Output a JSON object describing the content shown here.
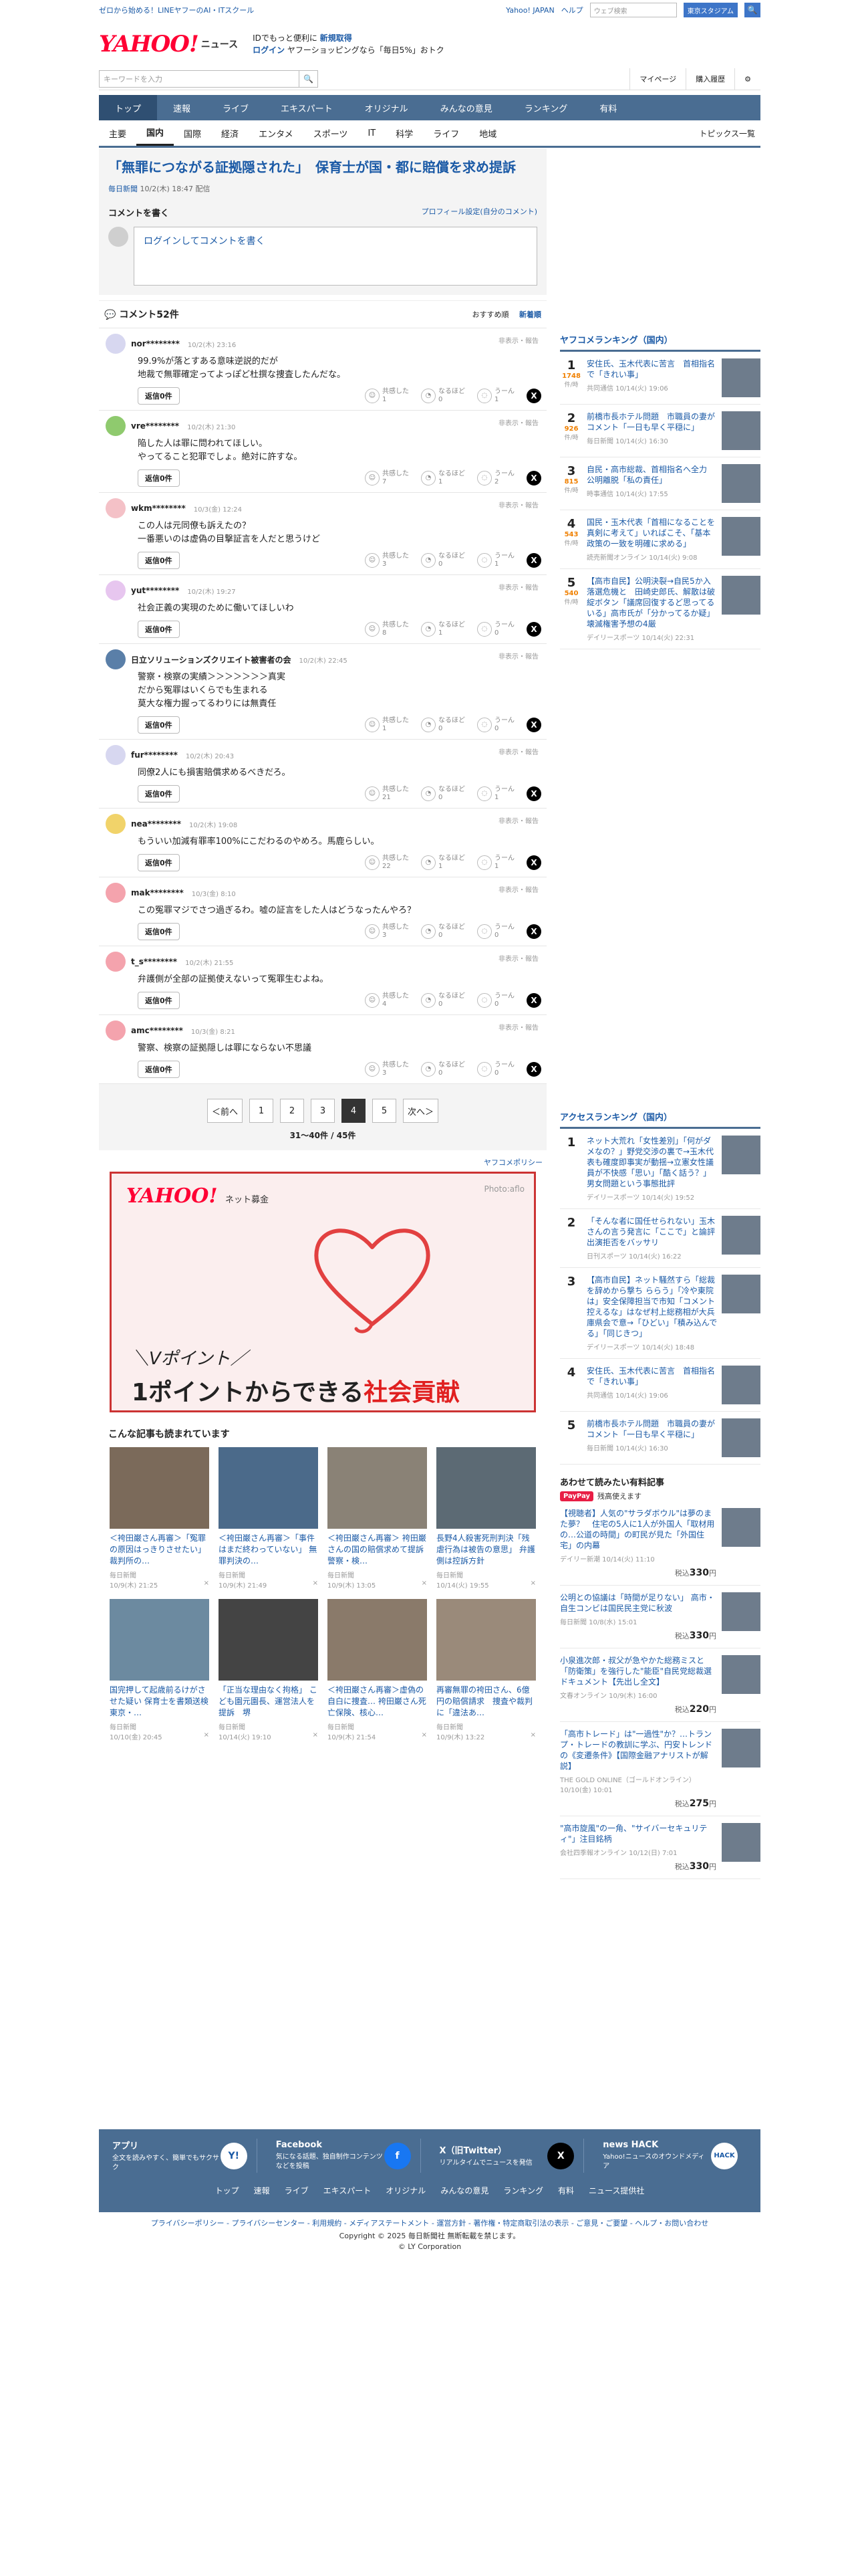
{
  "top": {
    "promo_link": "ゼロから始める！LINEヤフーのAI・ITスクール",
    "yahoo_link": "Yahoo! JAPAN",
    "help_link": "ヘルプ",
    "search_placeholder": "ウェブ検索",
    "search_button": "東京スタジアム"
  },
  "logo": {
    "text": "YAHOO!",
    "sub": "ニュース",
    "promo_line1_a": "IDでもっと便利に",
    "promo_line1_b": "新規取得",
    "promo_line2_a": "ログイン",
    "promo_line2_b": "ヤフーショッピングなら「毎日5%」おトク"
  },
  "search": {
    "placeholder": "キーワードを入力",
    "mypage": "マイページ",
    "history": "購入履歴"
  },
  "nav": [
    "トップ",
    "速報",
    "ライブ",
    "エキスパート",
    "オリジナル",
    "みんなの意見",
    "ランキング",
    "有料"
  ],
  "subnav": [
    "主要",
    "国内",
    "国際",
    "経済",
    "エンタメ",
    "スポーツ",
    "IT",
    "科学",
    "ライフ",
    "地域"
  ],
  "subnav_more": "トピックス一覧",
  "article": {
    "title": "「無罪につながる証拠隠された」　保育士が国・都に賠償を求め提訴",
    "source": "毎日新聞",
    "date": "10/2(木) 18:47 配信"
  },
  "comment_box": {
    "heading": "コメントを書く",
    "profile_link": "プロフィール設定(自分のコメント)",
    "login_text": "ログインしてコメントを書く"
  },
  "comments_header": {
    "title": "コメント52件",
    "sort_recommend": "おすすめ順",
    "sort_new": "新着順"
  },
  "labels": {
    "report": "非表示・報告",
    "reply": "返信0件",
    "empathy": "共感した",
    "naruhodo": "なるほど",
    "uun": "うーん"
  },
  "comments": [
    {
      "name": "nor********",
      "time": "10/2(木) 23:16",
      "text": "99.9%が落とすある意味逆説的だが\n地裁で無罪確定ってよっぽど杜撰な捜査したんだな。",
      "e": "1",
      "n": "0",
      "u": "1",
      "color": "#d7d7f0"
    },
    {
      "name": "vre********",
      "time": "10/2(木) 21:30",
      "text": "陥した人は罪に問われてほしい。\nやってること犯罪でしょ。絶対に許すな。",
      "e": "7",
      "n": "1",
      "u": "2",
      "color": "#8fca6e"
    },
    {
      "name": "wkm********",
      "time": "10/3(金) 12:24",
      "text": "この人は元同僚も訴えたの？\n一番悪いのは虚偽の目撃証言を人だと思うけど",
      "e": "3",
      "n": "0",
      "u": "1",
      "color": "#f4c1c7"
    },
    {
      "name": "yut********",
      "time": "10/2(木) 19:27",
      "text": "社会正義の実現のために働いてほしいわ",
      "e": "8",
      "n": "1",
      "u": "0",
      "color": "#e7c6ef"
    },
    {
      "name": "日立ソリューションズクリエイト被害者の会",
      "time": "10/2(木) 22:45",
      "text": "警察・検察の実績＞＞＞＞＞＞＞真実\nだから冤罪はいくらでも生まれる\n莫大な権力握ってるわりには無責任",
      "e": "1",
      "n": "0",
      "u": "0",
      "color": "#5a7fa8"
    },
    {
      "name": "fur********",
      "time": "10/2(木) 20:43",
      "text": "同僚2人にも損害賠償求めるべきだろ。",
      "e": "21",
      "n": "0",
      "u": "1",
      "color": "#d7d7f0"
    },
    {
      "name": "nea********",
      "time": "10/2(木) 19:08",
      "text": "もういい加減有罪率100%にこだわるのやめろ。馬鹿らしい。",
      "e": "22",
      "n": "1",
      "u": "1",
      "color": "#f1d36a"
    },
    {
      "name": "mak********",
      "time": "10/3(金) 8:10",
      "text": "この冤罪マジでさつ過ぎるわ。嘘の証言をした人はどうなったんやろ？",
      "e": "3",
      "n": "0",
      "u": "0",
      "color": "#f4a3ad"
    },
    {
      "name": "t_s********",
      "time": "10/2(木) 21:55",
      "text": "弁護側が全部の証拠使えないって冤罪生むよね。",
      "e": "4",
      "n": "0",
      "u": "0",
      "color": "#f4a3ad"
    },
    {
      "name": "amc********",
      "time": "10/3(金) 8:21",
      "text": "警察、検察の証拠隠しは罪にならない不思議",
      "e": "3",
      "n": "0",
      "u": "0",
      "color": "#f4a3ad"
    }
  ],
  "pager": {
    "prev": "＜前へ",
    "pages": [
      "1",
      "2",
      "3",
      "4",
      "5"
    ],
    "current": "4",
    "next": "次へ＞",
    "count": "31〜40件 / 45件"
  },
  "policy_link": "ヤフコメポリシー",
  "banner": {
    "logo": "YAHOO!",
    "service": "ネット募金",
    "photo": "Photo:aflo",
    "line1": "＼Vポイント／",
    "line2a": "1ポイントからできる",
    "line2b": "社会貢献"
  },
  "reads_title": "こんな記事も読まれています",
  "reads": [
    {
      "title": "＜袴田巌さん再審＞「冤罪の原因はっきりさせたい」 裁判所の…",
      "source": "毎日新聞",
      "date": "10/9(木) 21:25"
    },
    {
      "title": "＜袴田巌さん再審＞「事件はまだ終わっていない」 無罪判決の…",
      "source": "毎日新聞",
      "date": "10/9(木) 21:49"
    },
    {
      "title": "＜袴田巌さん再審＞ 袴田巌さんの国の賠償求めて提訴　警察・検…",
      "source": "毎日新聞",
      "date": "10/9(木) 13:05"
    },
    {
      "title": "長野4人殺害死刑判決「残虐行為は被告の意思」 弁護側は控訴方針",
      "source": "毎日新聞",
      "date": "10/14(火) 19:55"
    },
    {
      "title": "国完押して起歳前るけがさせた疑い 保育士を書類送検　東京・…",
      "source": "毎日新聞",
      "date": "10/10(金) 20:45"
    },
    {
      "title": "「正当な理由なく拘格」 こども園元園長、運営法人を提訴　堺",
      "source": "毎日新聞",
      "date": "10/14(火) 19:10"
    },
    {
      "title": "＜袴田巌さん再審＞虚偽の自白に捜査… 袴田巌さん死亡保険、核心…",
      "source": "毎日新聞",
      "date": "10/9(木) 21:54"
    },
    {
      "title": "再審無罪の袴田さん、6億円の賠償請求　捜査や裁判に「違法あ…",
      "source": "毎日新聞",
      "date": "10/9(木) 13:22"
    }
  ],
  "side": {
    "yahcom_title": "ヤフコメランキング（国内）",
    "yahcom": [
      {
        "n": "1",
        "c": "1748",
        "cs": "件/時",
        "t": "安住氏、玉木代表に苦言　首相指名で「きれい事」",
        "s": "共同通信 10/14(火) 19:06"
      },
      {
        "n": "2",
        "c": "926",
        "cs": "件/時",
        "t": "前橋市長ホテル問題　市職員の妻がコメント「一日も早く平穏に」",
        "s": "毎日新聞 10/14(火) 16:30"
      },
      {
        "n": "3",
        "c": "815",
        "cs": "件/時",
        "t": "自民・高市総裁、首相指名へ全力　公明離脱「私の責任」",
        "s": "時事通信 10/14(火) 17:55"
      },
      {
        "n": "4",
        "c": "543",
        "cs": "件/時",
        "t": "国民・玉木代表「首相になることを真剣に考えて」いればこそ、「基本政策の一致を明確に求める」",
        "s": "読売新聞オンライン 10/14(火) 9:08"
      },
      {
        "n": "5",
        "c": "540",
        "cs": "件/時",
        "t": "【高市自民】公明決裂→自民5か入落選危機と　田崎史郎氏、解散は破綻ボタン「議席回復するど思ってるいる」高市氏が「分かってるか疑」　壊滅権害予想の4厳",
        "s": "デイリースポーツ 10/14(火) 22:31"
      }
    ],
    "access_title": "アクセスランキング（国内）",
    "access": [
      {
        "n": "1",
        "t": "ネット大荒れ「女性差別」「何がダメなの？」野党交渉の裏で→玉木代表も確度即事実が動揺→立憲女性議員が不快感「思い」「酷く話う？」男女問題という事態批評",
        "s": "デイリースポーツ 10/14(火) 19:52"
      },
      {
        "n": "2",
        "t": "「そんな者に国任せられない」玉木さんの言う発言に「ここで」と論評　出演拒否をバッサリ",
        "s": "日刊スポーツ 10/14(火) 16:22"
      },
      {
        "n": "3",
        "t": "【高市自民】ネット騒然すら「総裁を辞めから撃ち ららう」「冷や東院は」安全保障担当で市知「コメント控えるな」はなぜ村上総務相が大兵庫県会で意→「ひどい」「積み込んでる」「同じきつ」",
        "s": "デイリースポーツ 10/14(火) 18:48"
      },
      {
        "n": "4",
        "t": "安住氏、玉木代表に苦言　首相指名で「きれい事」",
        "s": "共同通信 10/14(火) 19:06"
      },
      {
        "n": "5",
        "t": "前橋市長ホテル問題　市職員の妻がコメント「一日も早く平穏に」",
        "s": "毎日新聞 10/14(火) 16:30"
      }
    ],
    "paid_title": "あわせて読みたい有料記事",
    "paid_badge": "PayPay",
    "paid_badge_text": "残高使えます",
    "paid": [
      {
        "t": "【視聴者】人気の\"サラダボウル\"は夢のまた夢？　住宅の5人に1人が外国人「取材用の…公道の時間」の町民が見た「外国住宅」の内幕",
        "s": "デイリー新潮 10/14(火) 11:10",
        "p": "330"
      },
      {
        "t": "公明との協議は「時間が足りない」 高市・自生コンビは国民民主党に秋波",
        "s": "毎日新聞 10/8(水) 15:01",
        "p": "330"
      },
      {
        "t": "小泉進次郎・叔父が急やかた総務ミスと「防衛策」を強行した\"能臣\"自民党総裁選ドキュメント【先出し全文】",
        "s": "文春オンライン 10/9(木) 16:00",
        "p": "220"
      },
      {
        "t": "「高市トレード」は\"一過性\"か？…トランプ・トレードの教訓に学ぶ、円安トレンドの《変遷条件》【国際金融アナリストが解説】",
        "s": "THE GOLD ONLINE（ゴールドオンライン） 10/10(金) 10:01",
        "p": "275"
      },
      {
        "t": "\"高市旋風\"の一角、\"サイバーセキュリティ\"」注目銘柄",
        "s": "会社四季報オンライン 10/12(日) 7:01",
        "p": "330"
      }
    ],
    "yen": "円",
    "tax": "税込"
  },
  "footer": {
    "apps": [
      {
        "h": "アプリ",
        "d": "全文を読みやすく、簡単でもサクサク",
        "ic": "Y!"
      },
      {
        "h": "Facebook",
        "d": "気になる話題、独自制作コンテンツなどを投稿",
        "ic": "f"
      },
      {
        "h": "X（旧Twitter）",
        "d": "リアルタイムでニュースを発信",
        "ic": "X"
      },
      {
        "h": "news HACK",
        "d": "Yahoo!ニュースのオウンドメディア",
        "ic": "HACK"
      }
    ],
    "nav": [
      "トップ",
      "速報",
      "ライブ",
      "エキスパート",
      "オリジナル",
      "みんなの意見",
      "ランキング",
      "有料",
      "ニュース提供社"
    ],
    "legal": "プライバシーポリシー - プライバシーセンター - 利用規約 - メディアステートメント - 運営方針 - 著作権・特定商取引法の表示 - ご意見・ご要望 - ヘルプ・お問い合わせ",
    "copy1": "Copyright © 2025 毎日新聞社 無断転載を禁じます。",
    "copy2": "© LY Corporation"
  }
}
